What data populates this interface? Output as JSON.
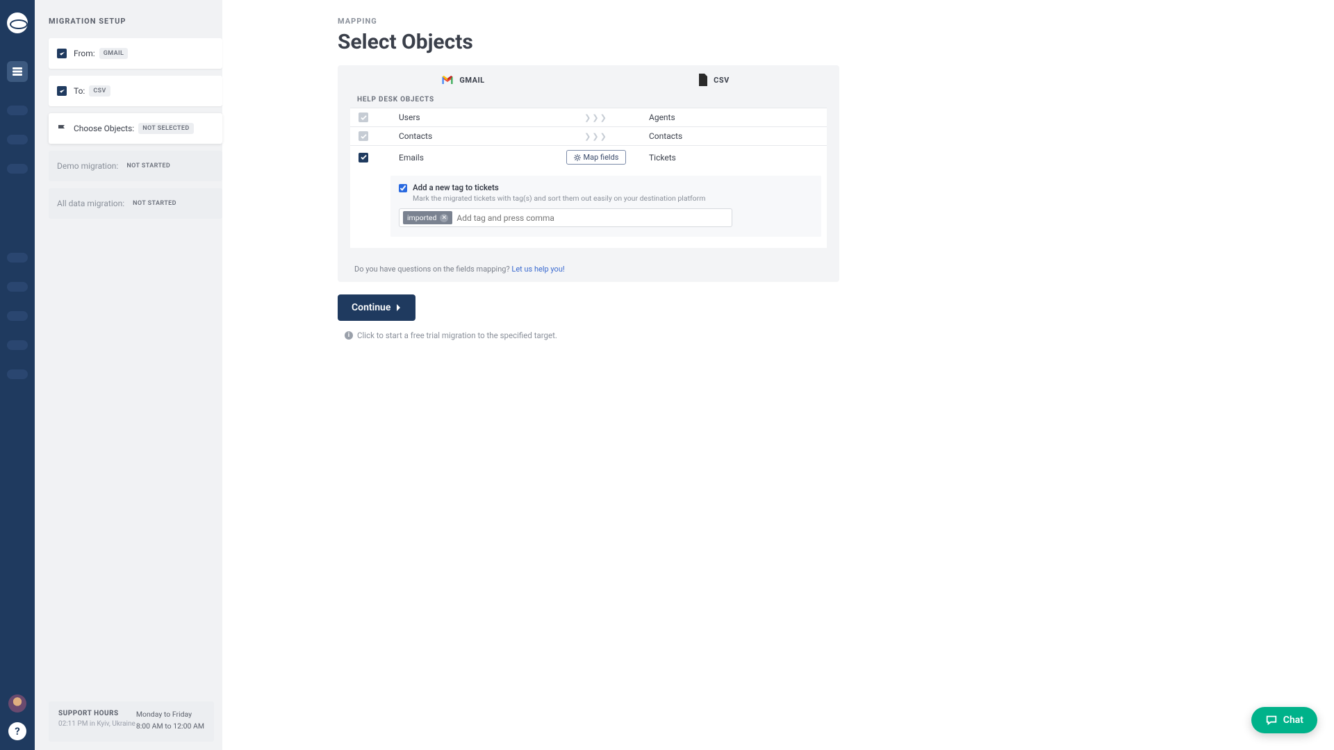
{
  "sidebar": {
    "title": "MIGRATION SETUP",
    "steps": [
      {
        "label": "From:",
        "badge": "GMAIL",
        "icon": "check"
      },
      {
        "label": "To:",
        "badge": "CSV",
        "icon": "check"
      },
      {
        "label": "Choose Objects:",
        "badge": "NOT SELECTED",
        "icon": "flag"
      },
      {
        "label": "Demo migration:",
        "badge": "NOT STARTED"
      },
      {
        "label": "All data migration:",
        "badge": "NOT STARTED"
      }
    ]
  },
  "support": {
    "heading": "SUPPORT HOURS",
    "time": "02:11 PM in Kyiv, Ukraine",
    "days": "Monday to Friday",
    "hours": "8:00 AM to 12:00 AM"
  },
  "main": {
    "eyebrow": "MAPPING",
    "title": "Select Objects",
    "source_label": "GMAIL",
    "target_label": "CSV",
    "section": "HELP DESK OBJECTS",
    "rows": [
      {
        "src": "Users",
        "dst": "Agents",
        "locked": true
      },
      {
        "src": "Contacts",
        "dst": "Contacts",
        "locked": true
      },
      {
        "src": "Emails",
        "dst": "Tickets",
        "locked": false,
        "map": true
      }
    ],
    "map_btn": "Map fields",
    "tag": {
      "title": "Add a new tag to tickets",
      "sub": "Mark the migrated tickets with tag(s) and sort them out easily on your destination platform",
      "chip": "imported",
      "placeholder": "Add tag and press comma"
    },
    "foot_q": "Do you have questions on the fields mapping? ",
    "foot_link": "Let us help you!",
    "continue": "Continue",
    "hint": "Click to start a free trial migration to the specified target."
  },
  "chat": {
    "label": "Chat"
  }
}
